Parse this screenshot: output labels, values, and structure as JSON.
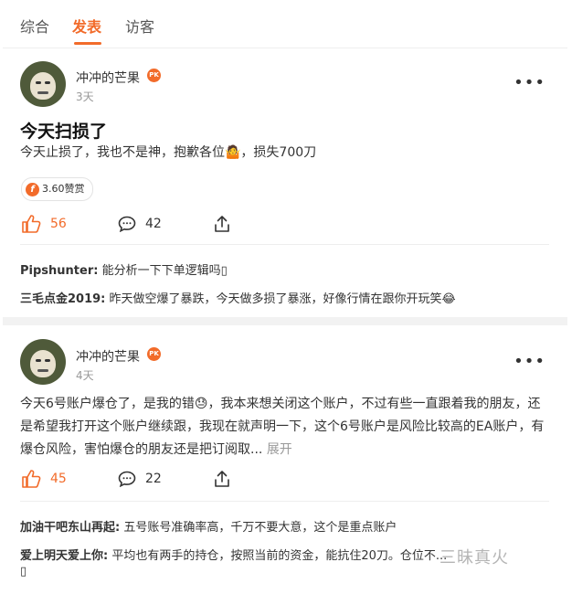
{
  "tabs": [
    {
      "label": "综合",
      "active": false
    },
    {
      "label": "发表",
      "active": true
    },
    {
      "label": "访客",
      "active": false
    }
  ],
  "accent_color": "#f26b2a",
  "posts": [
    {
      "username": "冲冲的芒果",
      "badge": "PK",
      "time": "3天",
      "title": "今天扫损了",
      "content": "今天止损了，我也不是神，抱歉各位🤷，损失700刀",
      "tip": "3.60赞赏",
      "likes": "56",
      "comments_count": "42",
      "comments": [
        {
          "name": "Pipshunter:",
          "text": " 能分析一下下单逻辑吗▯"
        },
        {
          "name": "三毛点金2019:",
          "text": " 昨天做空爆了暴跌，今天做多损了暴涨，好像行情在跟你开玩笑😂"
        }
      ]
    },
    {
      "username": "冲冲的芒果",
      "badge": "PK",
      "time": "4天",
      "content": "今天6号账户爆仓了，是我的错😓，我本来想关闭这个账户，不过有些一直跟着我的朋友，还是希望我打开这个账户继续跟，我现在就声明一下，这个6号账户是风险比较高的EA账户，有爆仓风险，害怕爆仓的朋友还是把订阅取...",
      "expand_label": "展开",
      "likes": "45",
      "comments_count": "22",
      "comments": [
        {
          "name": "加油干吧东山再起:",
          "text": " 五号账号准确率高，千万不要大意，这个是重点账户"
        },
        {
          "name": "爱上明天爱上你:",
          "text": " 平均也有两手的持仓，按照当前的资金，能抗住20刀。仓位不..."
        },
        {
          "name": "",
          "text": "▯"
        }
      ]
    }
  ],
  "watermark": "三昧真火"
}
